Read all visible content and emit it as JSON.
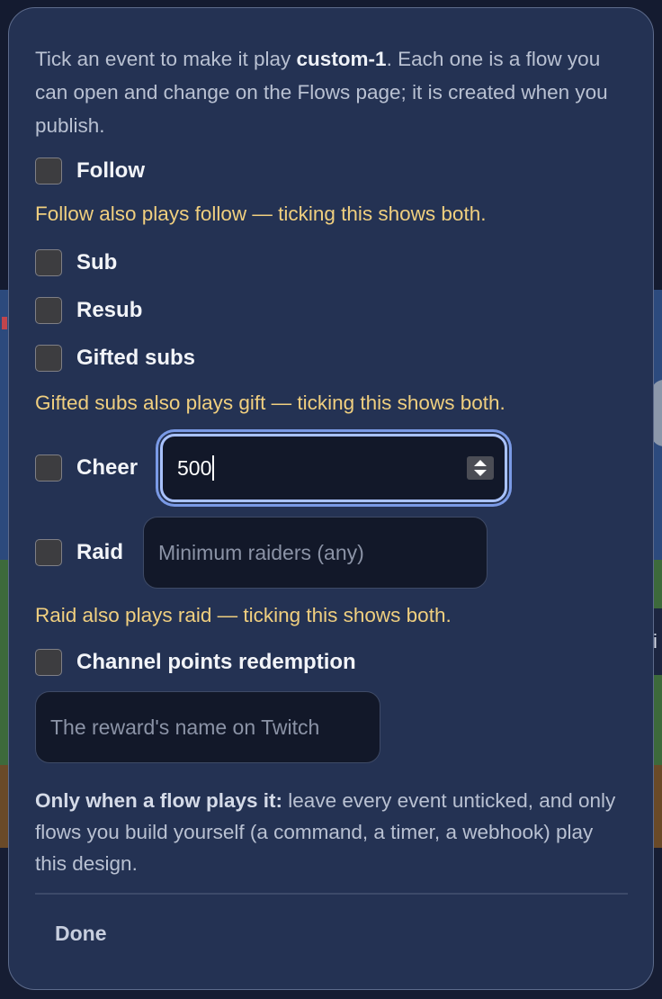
{
  "background": {
    "right_tab_letter": "i"
  },
  "intro": {
    "prefix": "Tick an event to make it play ",
    "design_name": "custom-1",
    "suffix": ". Each one is a flow you can open and change on the Flows page; it is created when you publish."
  },
  "events": {
    "follow": {
      "label": "Follow",
      "checked": false,
      "note": "Follow also plays follow — ticking this shows both."
    },
    "sub": {
      "label": "Sub",
      "checked": false
    },
    "resub": {
      "label": "Resub",
      "checked": false
    },
    "gifted_subs": {
      "label": "Gifted subs",
      "checked": false,
      "note": "Gifted subs also plays gift — ticking this shows both."
    },
    "cheer": {
      "label": "Cheer",
      "checked": false,
      "input_value": "500"
    },
    "raid": {
      "label": "Raid",
      "checked": false,
      "input_placeholder": "Minimum raiders (any)",
      "note": "Raid also plays raid — ticking this shows both."
    },
    "channel_points": {
      "label": "Channel points redemption",
      "checked": false,
      "input_placeholder": "The reward's name on Twitch"
    }
  },
  "footer": {
    "bold": "Only when a flow plays it:",
    "text": " leave every event unticked, and only flows you build yourself (a command, a timer, a webhook) play this design."
  },
  "done_label": "Done",
  "colors": {
    "dialog_bg": "#243253",
    "note_text": "#f0cf7f",
    "focus_ring": "#a9c2ff",
    "input_bg": "#121829"
  }
}
